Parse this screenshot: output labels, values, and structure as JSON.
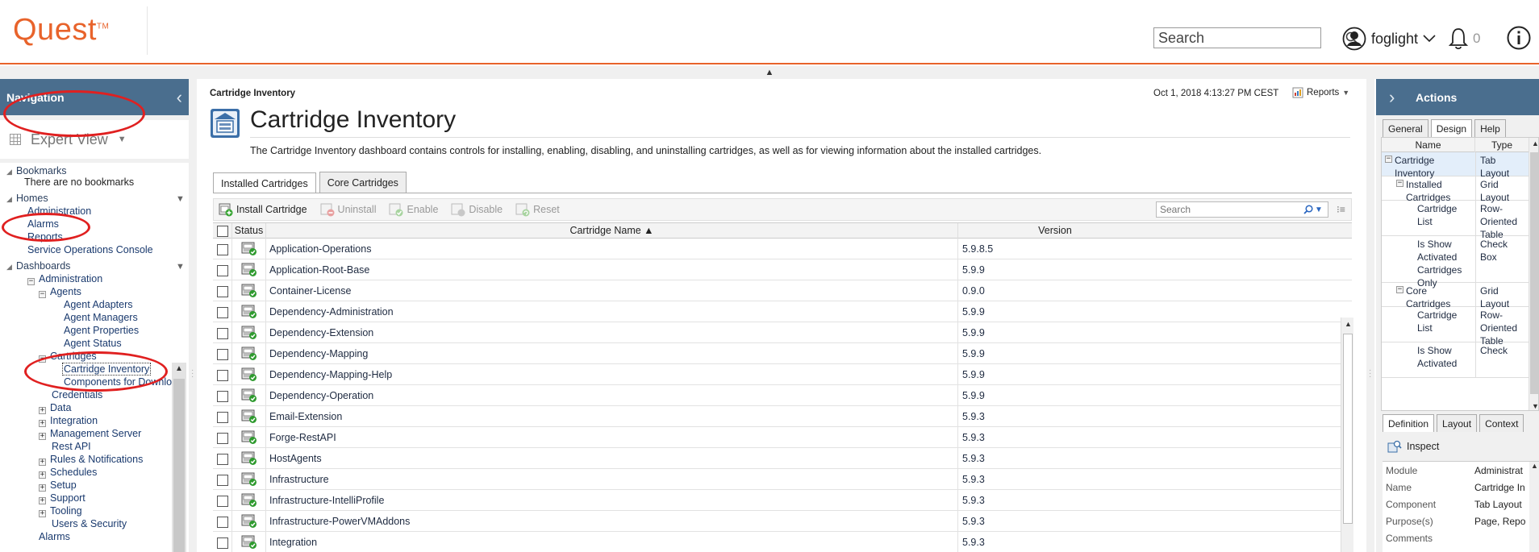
{
  "header": {
    "logo": "Quest",
    "logo_tm": "TM",
    "search_placeholder": "Search",
    "user": "foglight",
    "alert_count": "0"
  },
  "nav": {
    "title": "Navigation",
    "view": "Expert View",
    "bookmarks_label": "Bookmarks",
    "bookmarks_empty": "There are no bookmarks",
    "homes_label": "Homes",
    "homes": [
      "Administration",
      "Alarms",
      "Reports",
      "Service Operations Console"
    ],
    "dashboards_label": "Dashboards",
    "tree": {
      "administration": "Administration",
      "agents": "Agents",
      "agent_adapters": "Agent Adapters",
      "agent_managers": "Agent Managers",
      "agent_properties": "Agent Properties",
      "agent_status": "Agent Status",
      "cartridges": "Cartridges",
      "cartridge_inventory": "Cartridge Inventory",
      "components_for_download": "Components for Downlo",
      "credentials": "Credentials",
      "data": "Data",
      "integration": "Integration",
      "management_server": "Management Server",
      "rest_api": "Rest API",
      "rules_notifications": "Rules & Notifications",
      "schedules": "Schedules",
      "setup": "Setup",
      "support": "Support",
      "tooling": "Tooling",
      "users_security": "Users & Security",
      "alarms": "Alarms"
    }
  },
  "main": {
    "breadcrumb": "Cartridge Inventory",
    "timestamp": "Oct 1, 2018 4:13:27 PM CEST",
    "reports_label": "Reports",
    "title": "Cartridge Inventory",
    "description": "The Cartridge Inventory dashboard contains controls for installing, enabling, disabling, and uninstalling cartridges, as well as for viewing information about the installed cartridges.",
    "tabs": [
      "Installed Cartridges",
      "Core Cartridges"
    ],
    "toolbar": {
      "install": "Install Cartridge",
      "uninstall": "Uninstall",
      "enable": "Enable",
      "disable": "Disable",
      "reset": "Reset",
      "search_placeholder": "Search"
    },
    "columns": {
      "status": "Status",
      "name": "Cartridge Name ▲",
      "version": "Version"
    },
    "rows": [
      {
        "name": "Application-Operations",
        "version": "5.9.8.5"
      },
      {
        "name": "Application-Root-Base",
        "version": "5.9.9"
      },
      {
        "name": "Container-License",
        "version": "0.9.0"
      },
      {
        "name": "Dependency-Administration",
        "version": "5.9.9"
      },
      {
        "name": "Dependency-Extension",
        "version": "5.9.9"
      },
      {
        "name": "Dependency-Mapping",
        "version": "5.9.9"
      },
      {
        "name": "Dependency-Mapping-Help",
        "version": "5.9.9"
      },
      {
        "name": "Dependency-Operation",
        "version": "5.9.9"
      },
      {
        "name": "Email-Extension",
        "version": "5.9.3"
      },
      {
        "name": "Forge-RestAPI",
        "version": "5.9.3"
      },
      {
        "name": "HostAgents",
        "version": "5.9.3"
      },
      {
        "name": "Infrastructure",
        "version": "5.9.3"
      },
      {
        "name": "Infrastructure-IntelliProfile",
        "version": "5.9.3"
      },
      {
        "name": "Infrastructure-PowerVMAddons",
        "version": "5.9.3"
      },
      {
        "name": "Integration",
        "version": "5.9.3"
      }
    ]
  },
  "actions": {
    "title": "Actions",
    "tabs": [
      "General",
      "Design",
      "Help"
    ],
    "columns": {
      "name": "Name",
      "type": "Type"
    },
    "rows": [
      {
        "name": "Cartridge Inventory",
        "type": "Tab Layout"
      },
      {
        "name": "Installed Cartridges",
        "type": "Grid Layout"
      },
      {
        "name": "Cartridge List",
        "type": "Row-Oriented Table"
      },
      {
        "name": "Is Show Activated Cartridges Only",
        "type": "Check Box"
      },
      {
        "name": "Core Cartridges",
        "type": "Grid Layout"
      },
      {
        "name": "Cartridge List",
        "type": "Row-Oriented Table"
      },
      {
        "name": "Is Show Activated",
        "type": "Check"
      }
    ],
    "def_tabs": [
      "Definition",
      "Layout",
      "Context"
    ],
    "inspect": "Inspect",
    "props": [
      {
        "k": "Module",
        "v": "Administrat"
      },
      {
        "k": "Name",
        "v": "Cartridge In"
      },
      {
        "k": "Component",
        "v": "Tab Layout"
      },
      {
        "k": "Purpose(s)",
        "v": "Page, Repo"
      },
      {
        "k": "Comments",
        "v": ""
      }
    ]
  }
}
